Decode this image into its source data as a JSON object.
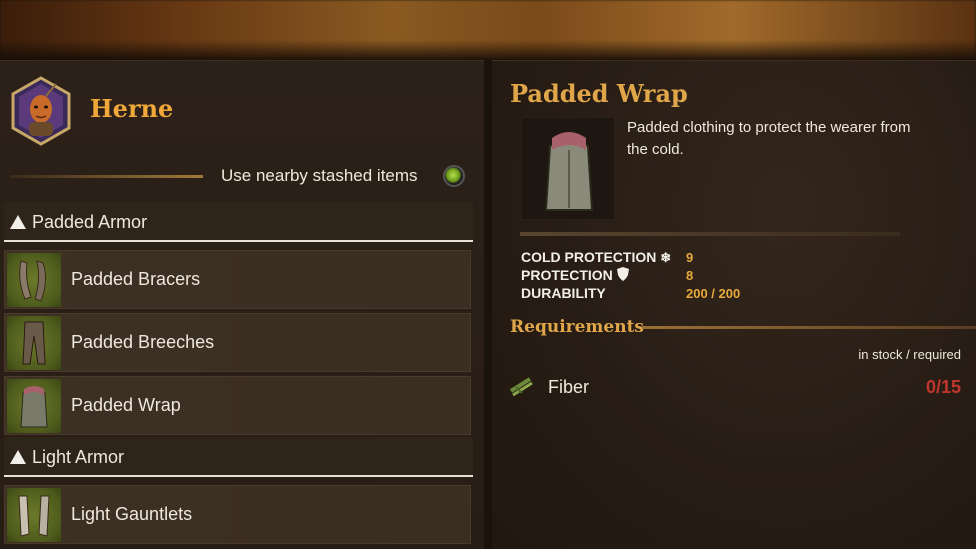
{
  "character": {
    "name": "Herne"
  },
  "stash": {
    "label": "Use nearby stashed items",
    "enabled": true
  },
  "categories": [
    {
      "label": "Padded Armor",
      "items": [
        {
          "label": "Padded Bracers",
          "icon": "bracers-icon"
        },
        {
          "label": "Padded Breeches",
          "icon": "breeches-icon"
        },
        {
          "label": "Padded Wrap",
          "icon": "wrap-icon"
        }
      ]
    },
    {
      "label": "Light Armor",
      "items": [
        {
          "label": "Light Gauntlets",
          "icon": "gauntlets-icon"
        }
      ]
    }
  ],
  "detail": {
    "title": "Padded Wrap",
    "description": "Padded clothing to protect the wearer from the cold.",
    "stats": [
      {
        "name": "COLD PROTECTION",
        "icon": "snowflake-icon",
        "value": "9"
      },
      {
        "name": "PROTECTION",
        "icon": "shield-icon",
        "value": "8"
      },
      {
        "name": "DURABILITY",
        "icon": "",
        "value": "200 / 200"
      }
    ],
    "requirements": {
      "title": "Requirements",
      "subtitle": "in stock / required",
      "items": [
        {
          "name": "Fiber",
          "icon": "fiber-icon",
          "count": "0/15"
        }
      ]
    }
  },
  "colors": {
    "accent": "#e0a64a",
    "name_orange": "#f0a83a",
    "insufficient": "#c0362c"
  }
}
